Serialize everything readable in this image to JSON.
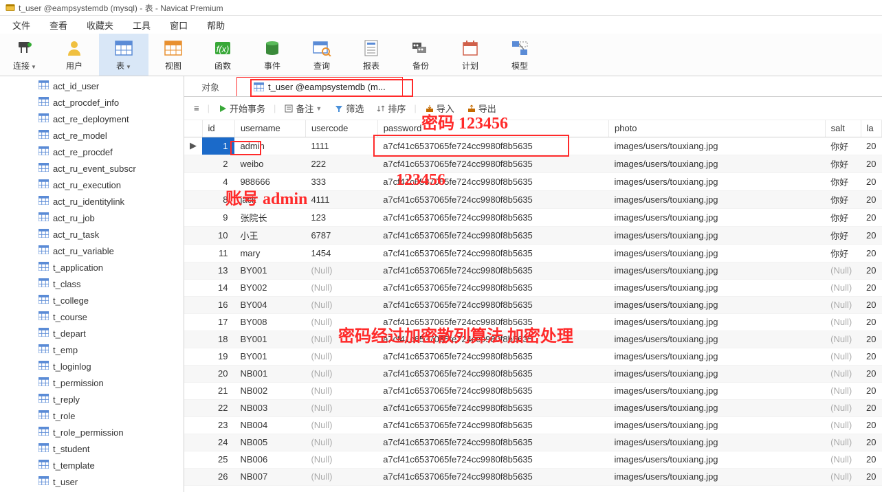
{
  "window_title": "t_user @eampsystemdb (mysql) - 表 - Navicat Premium",
  "menu": [
    "文件",
    "查看",
    "收藏夹",
    "工具",
    "窗口",
    "帮助"
  ],
  "toolbar": [
    {
      "label": "连接",
      "drop": true
    },
    {
      "label": "用户"
    },
    {
      "label": "表",
      "drop": true,
      "active": true
    },
    {
      "label": "视图"
    },
    {
      "label": "函数"
    },
    {
      "label": "事件"
    },
    {
      "label": "查询"
    },
    {
      "label": "报表"
    },
    {
      "label": "备份"
    },
    {
      "label": "计划"
    },
    {
      "label": "模型"
    }
  ],
  "tree": [
    "act_id_user",
    "act_procdef_info",
    "act_re_deployment",
    "act_re_model",
    "act_re_procdef",
    "act_ru_event_subscr",
    "act_ru_execution",
    "act_ru_identitylink",
    "act_ru_job",
    "act_ru_task",
    "act_ru_variable",
    "t_application",
    "t_class",
    "t_college",
    "t_course",
    "t_depart",
    "t_emp",
    "t_loginlog",
    "t_permission",
    "t_reply",
    "t_role",
    "t_role_permission",
    "t_student",
    "t_template",
    "t_user"
  ],
  "tabs": {
    "plain": "对象",
    "active": "t_user @eampsystemdb (m..."
  },
  "subtool": {
    "begin": "开始事务",
    "memo": "备注",
    "filter": "筛选",
    "sort": "排序",
    "import": "导入",
    "export": "导出"
  },
  "columns": [
    "",
    "id",
    "username",
    "usercode",
    "password",
    "photo",
    "salt",
    "la"
  ],
  "rows": [
    {
      "ind": "▶",
      "id": "1",
      "u": "admin",
      "c": "1111",
      "p": "a7cf41c6537065fe724cc9980f8b5635",
      "ph": "images/users/touxiang.jpg",
      "s": "你好",
      "l": "20",
      "sel": true
    },
    {
      "id": "2",
      "u": "weibo",
      "c": "222",
      "p": "a7cf41c6537065fe724cc9980f8b5635",
      "ph": "images/users/touxiang.jpg",
      "s": "你好",
      "l": "20"
    },
    {
      "id": "4",
      "u": "988666",
      "c": "333",
      "p": "a7cf41c6537065fe724cc9980f8b5635",
      "ph": "images/users/touxiang.jpg",
      "s": "你好",
      "l": "20"
    },
    {
      "id": "8",
      "u": "jack",
      "c": "4111",
      "p": "a7cf41c6537065fe724cc9980f8b5635",
      "ph": "images/users/touxiang.jpg",
      "s": "你好",
      "l": "20"
    },
    {
      "id": "9",
      "u": "张院长",
      "c": "123",
      "p": "a7cf41c6537065fe724cc9980f8b5635",
      "ph": "images/users/touxiang.jpg",
      "s": "你好",
      "l": "20"
    },
    {
      "id": "10",
      "u": "小王",
      "c": "6787",
      "p": "a7cf41c6537065fe724cc9980f8b5635",
      "ph": "images/users/touxiang.jpg",
      "s": "你好",
      "l": "20"
    },
    {
      "id": "11",
      "u": "mary",
      "c": "1454",
      "p": "a7cf41c6537065fe724cc9980f8b5635",
      "ph": "images/users/touxiang.jpg",
      "s": "你好",
      "l": "20"
    },
    {
      "id": "13",
      "u": "BY001",
      "c": null,
      "p": "a7cf41c6537065fe724cc9980f8b5635",
      "ph": "images/users/touxiang.jpg",
      "s": null,
      "l": "20"
    },
    {
      "id": "14",
      "u": "BY002",
      "c": null,
      "p": "a7cf41c6537065fe724cc9980f8b5635",
      "ph": "images/users/touxiang.jpg",
      "s": null,
      "l": "20"
    },
    {
      "id": "16",
      "u": "BY004",
      "c": null,
      "p": "a7cf41c6537065fe724cc9980f8b5635",
      "ph": "images/users/touxiang.jpg",
      "s": null,
      "l": "20"
    },
    {
      "id": "17",
      "u": "BY008",
      "c": null,
      "p": "a7cf41c6537065fe724cc9980f8b5635",
      "ph": "images/users/touxiang.jpg",
      "s": null,
      "l": "20"
    },
    {
      "id": "18",
      "u": "BY001",
      "c": null,
      "p": "a7cf41c6537065fe724cc9980f8b5635",
      "ph": "images/users/touxiang.jpg",
      "s": null,
      "l": "20"
    },
    {
      "id": "19",
      "u": "BY001",
      "c": null,
      "p": "a7cf41c6537065fe724cc9980f8b5635",
      "ph": "images/users/touxiang.jpg",
      "s": null,
      "l": "20"
    },
    {
      "id": "20",
      "u": "NB001",
      "c": null,
      "p": "a7cf41c6537065fe724cc9980f8b5635",
      "ph": "images/users/touxiang.jpg",
      "s": null,
      "l": "20"
    },
    {
      "id": "21",
      "u": "NB002",
      "c": null,
      "p": "a7cf41c6537065fe724cc9980f8b5635",
      "ph": "images/users/touxiang.jpg",
      "s": null,
      "l": "20"
    },
    {
      "id": "22",
      "u": "NB003",
      "c": null,
      "p": "a7cf41c6537065fe724cc9980f8b5635",
      "ph": "images/users/touxiang.jpg",
      "s": null,
      "l": "20"
    },
    {
      "id": "23",
      "u": "NB004",
      "c": null,
      "p": "a7cf41c6537065fe724cc9980f8b5635",
      "ph": "images/users/touxiang.jpg",
      "s": null,
      "l": "20"
    },
    {
      "id": "24",
      "u": "NB005",
      "c": null,
      "p": "a7cf41c6537065fe724cc9980f8b5635",
      "ph": "images/users/touxiang.jpg",
      "s": null,
      "l": "20"
    },
    {
      "id": "25",
      "u": "NB006",
      "c": null,
      "p": "a7cf41c6537065fe724cc9980f8b5635",
      "ph": "images/users/touxiang.jpg",
      "s": null,
      "l": "20"
    },
    {
      "id": "26",
      "u": "NB007",
      "c": null,
      "p": "a7cf41c6537065fe724cc9980f8b5635",
      "ph": "images/users/touxiang.jpg",
      "s": null,
      "l": "20"
    }
  ],
  "annotations": {
    "a1": "密码 123456",
    "a2": "账号 admin",
    "a3": "123456",
    "a4": "密码经过加密散列算法 加密处理"
  },
  "null_text": "(Null)"
}
